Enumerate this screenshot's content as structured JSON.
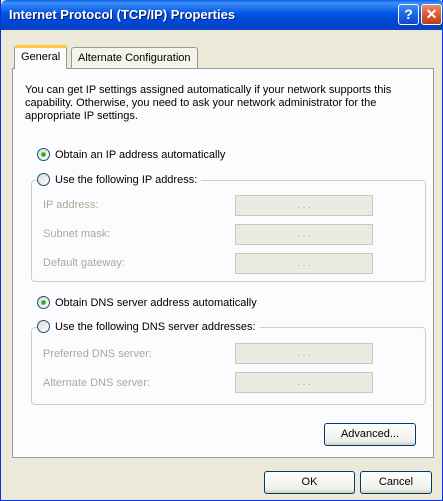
{
  "window": {
    "title": "Internet Protocol (TCP/IP) Properties",
    "help_glyph": "?",
    "close_glyph": "✕"
  },
  "tabs": [
    {
      "label": "General",
      "selected": true
    },
    {
      "label": "Alternate Configuration",
      "selected": false
    }
  ],
  "description": "You can get IP settings assigned automatically if your network supports this capability. Otherwise, you need to ask your network administrator for the appropriate IP settings.",
  "ip": {
    "auto_label": "Obtain an IP address automatically",
    "auto_checked": true,
    "manual_label": "Use the following IP address:",
    "manual_checked": false,
    "fields": [
      {
        "label": "IP address:",
        "value": ". . ."
      },
      {
        "label": "Subnet mask:",
        "value": ". . ."
      },
      {
        "label": "Default gateway:",
        "value": ". . ."
      }
    ]
  },
  "dns": {
    "auto_label": "Obtain DNS server address automatically",
    "auto_checked": true,
    "manual_label": "Use the following DNS server addresses:",
    "manual_checked": false,
    "fields": [
      {
        "label": "Preferred DNS server:",
        "value": ". . ."
      },
      {
        "label": "Alternate DNS server:",
        "value": ". . ."
      }
    ]
  },
  "buttons": {
    "advanced": "Advanced...",
    "ok": "OK",
    "cancel": "Cancel"
  },
  "colors": {
    "titlebar": "#0054e3",
    "dialog_bg": "#ece9d8",
    "radio_dot": "#21a121",
    "disabled_text": "#aca899"
  }
}
